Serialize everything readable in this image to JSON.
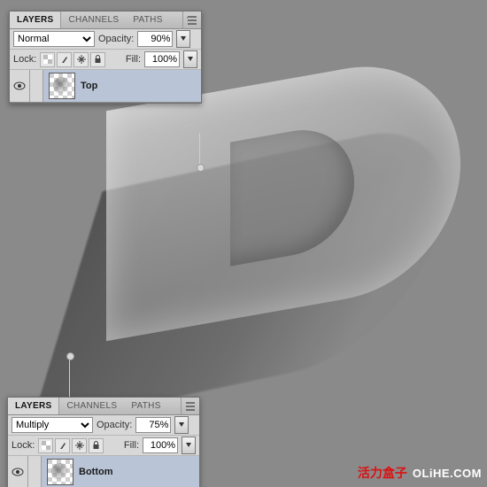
{
  "tabs": {
    "layers": "LAYERS",
    "channels": "CHANNELS",
    "paths": "PATHS"
  },
  "labels": {
    "opacity": "Opacity:",
    "lock": "Lock:",
    "fill": "Fill:"
  },
  "panel1": {
    "blend": "Normal",
    "opacity": "90%",
    "fill": "100%",
    "layer_name": "Top"
  },
  "panel2": {
    "blend": "Multiply",
    "opacity": "75%",
    "fill": "100%",
    "layer_name": "Bottom"
  },
  "blend_options": [
    "Normal",
    "Multiply"
  ],
  "watermark": {
    "cn": "活力盒子",
    "en": "OLiHE.COM"
  }
}
